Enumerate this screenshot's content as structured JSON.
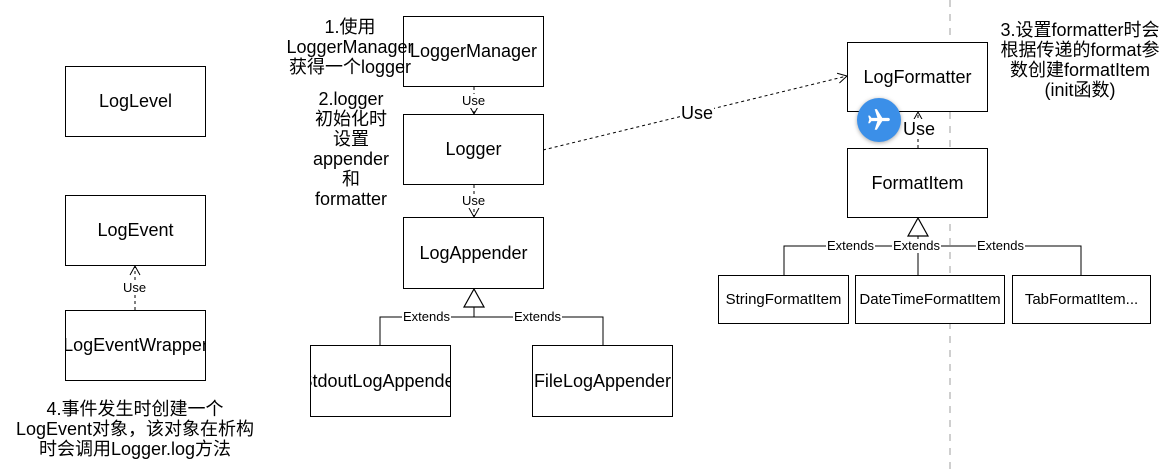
{
  "boxes": {
    "log_level": "LogLevel",
    "log_event": "LogEvent",
    "log_event_wrapper": "LogEventWrapper",
    "logger_manager": "LoggerManager",
    "logger": "Logger",
    "log_appender": "LogAppender",
    "stdout_log_appender": "StdoutLogAppender",
    "file_log_appender": "FileLogAppender",
    "log_formatter": "LogFormatter",
    "format_item": "FormatItem",
    "string_format_item": "StringFormatItem",
    "datetime_format_item": "DateTimeFormatItem",
    "tab_format_item": "TabFormatItem..."
  },
  "edges": {
    "use": "Use",
    "extends": "Extends"
  },
  "notes": {
    "note1": [
      "1.使用",
      "LoggerManager",
      "获得一个logger"
    ],
    "note2": [
      "2.logger",
      "初始化时",
      "设置",
      "appender",
      "和",
      "formatter"
    ],
    "note3": [
      "3.设置formatter时会",
      "根据传递的format参",
      "数创建formatItem",
      "(init函数)"
    ],
    "note4": [
      "4.事件发生时创建一个",
      "LogEvent对象，该对象在析构",
      "时会调用Logger.log方法"
    ]
  },
  "colors": {
    "line": "#000000",
    "divider": "#bfbfbf",
    "fab_background": "#3b8fe8",
    "fab_icon": "#ffffff"
  },
  "icons": {
    "floating_button": "airplane-icon"
  }
}
